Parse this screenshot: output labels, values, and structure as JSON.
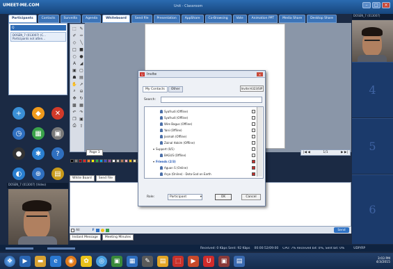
{
  "app": {
    "logo": "UMEET-ME.COM",
    "window_title": "Unit - Classroom"
  },
  "tabs": [
    {
      "label": "Participants"
    },
    {
      "label": "Contacts"
    },
    {
      "label": "Surveilla"
    },
    {
      "label": "Agenda"
    },
    {
      "label": "Whiteboard"
    },
    {
      "label": "Send file"
    },
    {
      "label": "Presentation"
    },
    {
      "label": "AppShare"
    },
    {
      "label": "Co-Browsing"
    },
    {
      "label": "Vote"
    },
    {
      "label": "Animation PPT"
    },
    {
      "label": "Media Share"
    },
    {
      "label": "Desktop Share"
    }
  ],
  "participants": {
    "search_label": "Q",
    "item_name": "DOSEN_7 (013007) (C...",
    "item_status": "Participants not atten..."
  },
  "left_video": {
    "label": "DOSEN_7 (013007) (Video)"
  },
  "right_video": {
    "label": "DOSEN_7 (013007)"
  },
  "video_slots": [
    "4",
    "5",
    "6"
  ],
  "whiteboard": {
    "page_tab": "Page 1",
    "page_counter": "1/1",
    "subtabs": [
      "White Board",
      "Send File"
    ]
  },
  "chat": {
    "recipient": "All",
    "send_label": "Send",
    "tabs": [
      "Instant Message",
      "Meeting Minutes"
    ]
  },
  "status": {
    "received": "Received: 0 Kbps Sent: 92 Kbps",
    "timer": "00:00:52/09:00",
    "cpu": "CPU: 7%  Received bit: 0%, Sent bit: 0%",
    "conn": "UDP/RP"
  },
  "clock": {
    "time": "3:03 PM",
    "date": "4/3/2015"
  },
  "dialog": {
    "title": "Invite",
    "tabs": [
      "My Contacts",
      "Other"
    ],
    "invite_btn": "Invite H323/SIP",
    "search_label": "Search:",
    "contacts": [
      {
        "name": "Syafrudi (Offline)",
        "type": "person",
        "checked": false
      },
      {
        "name": "Syafrudi (Offline)",
        "type": "person",
        "checked": false
      },
      {
        "name": "Wire Bagus (Offline)",
        "type": "person",
        "checked": false
      },
      {
        "name": "Yani (Offline)",
        "type": "person",
        "checked": false
      },
      {
        "name": "Josmah (Offline)",
        "type": "person",
        "checked": false
      },
      {
        "name": "Zainal Hakim (Offline)",
        "type": "person",
        "checked": false
      },
      {
        "name": "Support (0/1)",
        "type": "group",
        "checked": false
      },
      {
        "name": "BAGUS (Offline)",
        "type": "person",
        "checked": false
      },
      {
        "name": "Friends (2/3)",
        "type": "group-hl",
        "checked": true
      },
      {
        "name": "Aguan S (Online)",
        "type": "person",
        "checked": true
      },
      {
        "name": "Arya (Online) - Dota God on Earth",
        "type": "person",
        "checked": true
      }
    ],
    "role_label": "Role:",
    "role_value": "Participant",
    "ok": "OK",
    "cancel": "Cancel"
  },
  "colors": {
    "palette": [
      "#000000",
      "#7f7f7f",
      "#880015",
      "#ed1c24",
      "#ff7f27",
      "#fff200",
      "#22b14c",
      "#00a2e8",
      "#3f48cc",
      "#a349a4",
      "#ffffff",
      "#c3c3c3",
      "#b97a57",
      "#ffaec9",
      "#ffc90e",
      "#efe4b0",
      "#b5e61d",
      "#99d9ea",
      "#7092be",
      "#c8bfe7",
      "#404040",
      "#e0e0e0",
      "#ff00ff",
      "#00ffff",
      "#0000ff",
      "#00ff00",
      "#ff0000",
      "#ffff00"
    ]
  }
}
